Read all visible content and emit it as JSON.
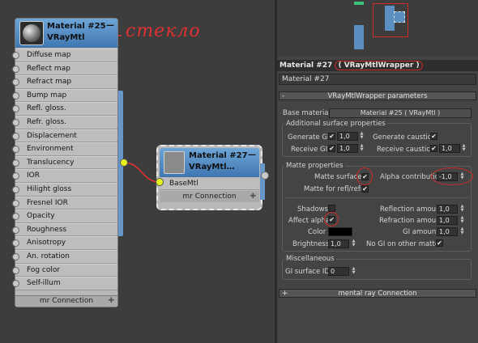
{
  "node_editor": {
    "node1": {
      "title": "Material #25",
      "type": "VRayMtl",
      "minus": "—",
      "slots": [
        "Diffuse map",
        "Reflect map",
        "Refract map",
        "Bump map",
        "Refl. gloss.",
        "Refr. gloss.",
        "Displacement",
        "Environment",
        "Translucency",
        "IOR",
        "Hilight gloss",
        "Fresnel IOR",
        "Opacity",
        "Roughness",
        "Anisotropy",
        "An. rotation",
        "Fog color",
        "Self-illum"
      ],
      "footer": "mr Connection",
      "plus": "✚"
    },
    "node2": {
      "title": "Material #27",
      "type": "VRayMtl…",
      "minus": "—",
      "slot": "BaseMtl",
      "footer": "mr Connection",
      "plus": "✚"
    },
    "annotation": "стекло",
    "colors": {
      "node_header": "#4f86c0",
      "pin_active": "#e4f11a",
      "wire": "#e83030",
      "annotation": "#e03030"
    }
  },
  "panel": {
    "title_prefix": "Material #27",
    "title_type": "( VRayMtlWrapper )",
    "name_field": "Material #27",
    "rollout_params": {
      "toggle": "-",
      "title": "VRayMtlWrapper parameters"
    },
    "base_material_label": "Base material:",
    "base_material_value": "Material #25  ( VRayMtl )",
    "additional": {
      "title": "Additional surface properties",
      "generate_gi": "Generate GI",
      "generate_gi_value": "1,0",
      "generate_caustics": "Generate caustics",
      "receive_gi": "Receive GI",
      "receive_gi_value": "1,0",
      "receive_caustics": "Receive caustics",
      "receive_caustics_value": "1,0"
    },
    "matte": {
      "title": "Matte properties",
      "matte_surface": "Matte surface",
      "alpha_contribution": "Alpha contribution",
      "alpha_value": "-1,0",
      "matte_refl": "Matte for refl/refr",
      "shadows": "Shadows",
      "reflection_amount": "Reflection amount",
      "reflection_value": "1,0",
      "affect_alpha": "Affect alpha",
      "refraction_amount": "Refraction amount",
      "refraction_value": "1,0",
      "color": "Color",
      "gi_amount": "GI amount",
      "gi_value": "1,0",
      "brightness": "Brightness",
      "brightness_value": "1,0",
      "no_gi": "No GI on other mattes"
    },
    "misc": {
      "title": "Miscellaneous",
      "gi_surface_id": "GI surface ID",
      "gi_surface_value": "0"
    },
    "rollout_mr": {
      "toggle": "+",
      "title": "mental ray Connection"
    },
    "check_mark": "✔",
    "colors": {
      "highlight_circle": "#d02a2a",
      "matte_color": "#000000"
    }
  }
}
